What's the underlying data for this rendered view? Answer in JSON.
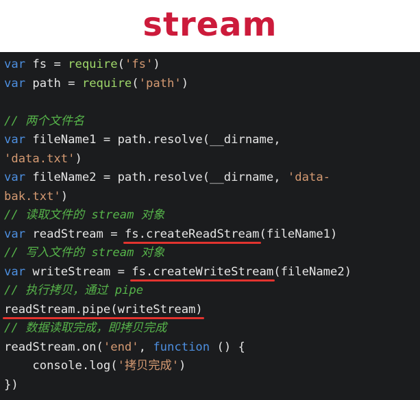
{
  "slide": {
    "title": "stream"
  },
  "code": {
    "lines": [
      [
        {
          "t": "var",
          "c": "kw"
        },
        {
          "t": " fs = ",
          "c": "plain"
        },
        {
          "t": "require",
          "c": "call"
        },
        {
          "t": "(",
          "c": "plain"
        },
        {
          "t": "'fs'",
          "c": "str"
        },
        {
          "t": ")",
          "c": "plain"
        }
      ],
      [
        {
          "t": "var",
          "c": "kw"
        },
        {
          "t": " path = ",
          "c": "plain"
        },
        {
          "t": "require",
          "c": "call"
        },
        {
          "t": "(",
          "c": "plain"
        },
        {
          "t": "'path'",
          "c": "str"
        },
        {
          "t": ")",
          "c": "plain"
        }
      ],
      [],
      [
        {
          "t": "// 两个文件名",
          "c": "cmt"
        }
      ],
      [
        {
          "t": "var",
          "c": "kw"
        },
        {
          "t": " fileName1 = path.resolve(__dirname,",
          "c": "plain"
        }
      ],
      [
        {
          "t": "'data.txt'",
          "c": "str"
        },
        {
          "t": ")",
          "c": "plain"
        }
      ],
      [
        {
          "t": "var",
          "c": "kw"
        },
        {
          "t": " fileName2 = path.resolve(__dirname, ",
          "c": "plain"
        },
        {
          "t": "'data-",
          "c": "str"
        }
      ],
      [
        {
          "t": "bak.txt'",
          "c": "str"
        },
        {
          "t": ")",
          "c": "plain"
        }
      ],
      [
        {
          "t": "// 读取文件的 stream 对象",
          "c": "cmt"
        }
      ],
      [
        {
          "t": "var",
          "c": "kw"
        },
        {
          "t": " readStream = ",
          "c": "plain"
        },
        {
          "t": "fs.createReadStream",
          "c": "plain",
          "mark": true
        },
        {
          "t": "(fileName1)",
          "c": "plain"
        }
      ],
      [
        {
          "t": "// 写入文件的 stream 对象",
          "c": "cmt"
        }
      ],
      [
        {
          "t": "var",
          "c": "kw"
        },
        {
          "t": " writeStream = ",
          "c": "plain"
        },
        {
          "t": "fs.createWriteStream",
          "c": "plain",
          "mark": true
        },
        {
          "t": "(fileName2)",
          "c": "plain"
        }
      ],
      [
        {
          "t": "// 执行拷贝，通过 pipe",
          "c": "cmt"
        }
      ],
      [
        {
          "t": "readStream.pipe(writeStream)",
          "c": "plain",
          "mark": true
        }
      ],
      [
        {
          "t": "// 数据读取完成，即拷贝完成",
          "c": "cmt"
        }
      ],
      [
        {
          "t": "readStream.on(",
          "c": "plain"
        },
        {
          "t": "'end'",
          "c": "str"
        },
        {
          "t": ", ",
          "c": "plain"
        },
        {
          "t": "function",
          "c": "fn"
        },
        {
          "t": " () {",
          "c": "plain"
        }
      ],
      [
        {
          "t": "    console.",
          "c": "plain"
        },
        {
          "t": "log",
          "c": "plain"
        },
        {
          "t": "(",
          "c": "plain"
        },
        {
          "t": "'拷贝完成'",
          "c": "str"
        },
        {
          "t": ")",
          "c": "plain"
        }
      ],
      [
        {
          "t": "})",
          "c": "plain"
        }
      ]
    ]
  },
  "colors": {
    "title": "#cc1b3b",
    "background": "#1b1c1e",
    "keyword": "#4d8fe0",
    "call": "#9fd86a",
    "string": "#d59a72",
    "comment": "#56b44a",
    "underline": "#e3342f"
  }
}
